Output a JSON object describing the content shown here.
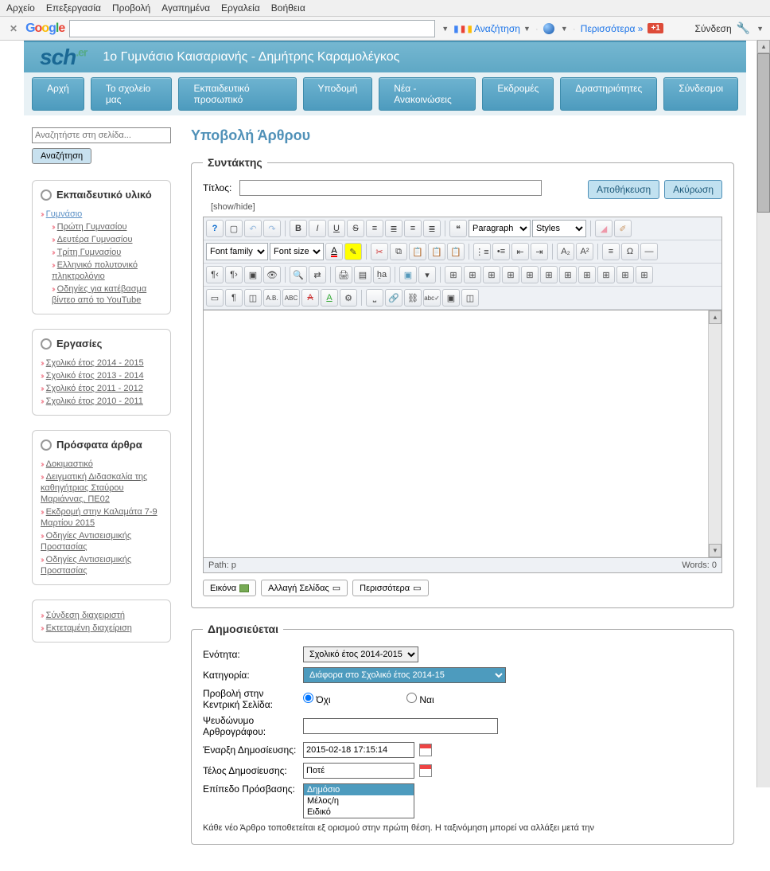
{
  "browser_menu": [
    "Αρχείο",
    "Επεξεργασία",
    "Προβολή",
    "Αγαπημένα",
    "Εργαλεία",
    "Βοήθεια"
  ],
  "google_bar": {
    "search_label": "Αναζήτηση",
    "more_label": "Περισσότερα »",
    "gplus": "+1",
    "signin": "Σύνδεση"
  },
  "site": {
    "logo": "sch",
    "logo_suffix": ".er",
    "title": "1ο Γυμνάσιο Καισαριανής - Δημήτρης Καραμολέγκος"
  },
  "nav": [
    "Αρχή",
    "Το σχολείο μας",
    "Εκπαιδευτικό προσωπικό",
    "Υποδομή",
    "Νέα - Ανακοινώσεις",
    "Εκδρομές",
    "Δραστηριότητες",
    "Σύνδεσμοι"
  ],
  "sidebar": {
    "search_placeholder": "Αναζητήστε στη σελίδα...",
    "search_button": "Αναζήτηση",
    "box1_title": "Εκπαιδευτικό υλικό",
    "box1_top": "Γυμνάσιο",
    "box1_items": [
      "Πρώτη Γυμνασίου",
      "Δευτέρα Γυμνασίου",
      "Τρίτη Γυμνασίου",
      "Ελληνικό πολυτονικό πληκτρολόγιο",
      "Οδηγίες για κατέβασμα βίντεο από το YouTube"
    ],
    "box2_title": "Εργασίες",
    "box2_items": [
      "Σχολικό έτος 2014 - 2015",
      "Σχολικό έτος 2013 - 2014",
      "Σχολικό έτος 2011 - 2012",
      "Σχολικό έτος 2010 - 2011"
    ],
    "box3_title": "Πρόσφατα άρθρα",
    "box3_items": [
      "Δοκιμαστικό",
      "Δειγματική Διδασκαλία της καθηγήτριας Σταύρου Μαριάννας, ΠΕ02",
      "Εκδρομή στην Καλαμάτα 7-9 Μαρτίου 2015",
      "Οδηγίες Αντισεισμικής Προστασίας",
      "Οδηγίες Αντισεισμικής Προστασίας"
    ],
    "box4_items": [
      "Σύνδεση διαχειριστή",
      "Εκτεταμένη διαχείριση"
    ]
  },
  "main": {
    "page_title": "Υποβολή Άρθρου",
    "editor_legend": "Συντάκτης",
    "title_label": "Τίτλος:",
    "save_btn": "Αποθήκευση",
    "cancel_btn": "Ακύρωση",
    "showhide": "[show/hide]",
    "paragraph_sel": "Paragraph",
    "styles_sel": "Styles",
    "fontfamily_sel": "Font family",
    "fontsize_sel": "Font size",
    "path_label": "Path:",
    "path_value": "p",
    "words_label": "Words: 0",
    "btn_image": "Εικόνα",
    "btn_pagebreak": "Αλλαγή Σελίδας",
    "btn_readmore": "Περισσότερα"
  },
  "publish": {
    "legend": "Δημοσιεύεται",
    "section_label": "Ενότητα:",
    "section_value": "Σχολικό έτος 2014-2015",
    "category_label": "Κατηγορία:",
    "category_value": "Διάφορα στο Σχολικό έτος 2014-15",
    "frontpage_label": "Προβολή στην Κεντρική Σελίδα:",
    "no_label": "Όχι",
    "yes_label": "Ναι",
    "alias_label": "Ψευδώνυμο Αρθρογράφου:",
    "start_label": "Έναρξη Δημοσίευσης:",
    "start_value": "2015-02-18 17:15:14",
    "end_label": "Τέλος Δημοσίευσης:",
    "end_value": "Ποτέ",
    "access_label": "Επίπεδο Πρόσβασης:",
    "access_options": [
      "Δημόσιο",
      "Μέλος/η",
      "Ειδικό"
    ],
    "note": "Κάθε νέο Άρθρο τοποθετείται εξ ορισμού στην πρώτη θέση. Η ταξινόμηση μπορεί να αλλάξει μετά την"
  }
}
